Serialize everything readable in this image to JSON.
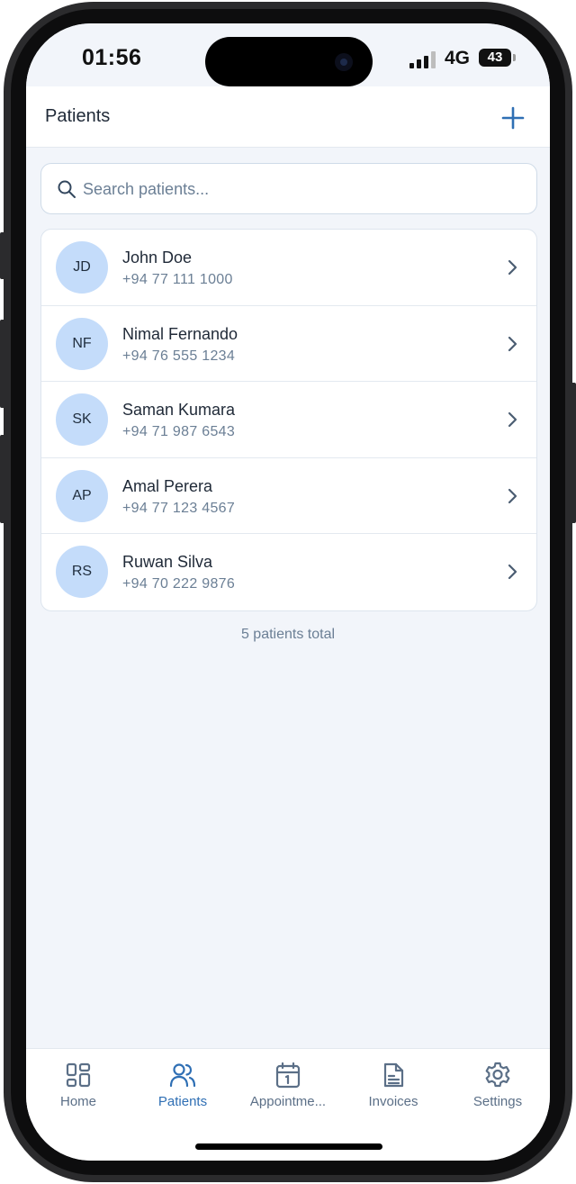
{
  "status_bar": {
    "time": "01:56",
    "network": "4G",
    "battery": "43"
  },
  "header": {
    "title": "Patients",
    "add_icon": "plus-icon"
  },
  "search": {
    "placeholder": "Search patients...",
    "value": "",
    "icon": "search-icon"
  },
  "patients": [
    {
      "initials": "JD",
      "name": "John Doe",
      "phone": "+94 77 111 1000"
    },
    {
      "initials": "NF",
      "name": "Nimal Fernando",
      "phone": "+94 76 555 1234"
    },
    {
      "initials": "SK",
      "name": "Saman Kumara",
      "phone": "+94 71 987 6543"
    },
    {
      "initials": "AP",
      "name": "Amal Perera",
      "phone": "+94 77 123 4567"
    },
    {
      "initials": "RS",
      "name": "Ruwan Silva",
      "phone": "+94 70 222 9876"
    }
  ],
  "total_text": "5 patients total",
  "tabs": [
    {
      "label": "Home",
      "icon": "home-grid-icon",
      "active": false
    },
    {
      "label": "Patients",
      "icon": "users-icon",
      "active": true
    },
    {
      "label": "Appointme...",
      "icon": "calendar-icon",
      "active": false
    },
    {
      "label": "Invoices",
      "icon": "document-icon",
      "active": false
    },
    {
      "label": "Settings",
      "icon": "gear-icon",
      "active": false
    }
  ],
  "colors": {
    "accent": "#2f6fb4",
    "background": "#f2f5fa",
    "avatar": "#c4dcfa",
    "muted_text": "#6b7f95"
  }
}
